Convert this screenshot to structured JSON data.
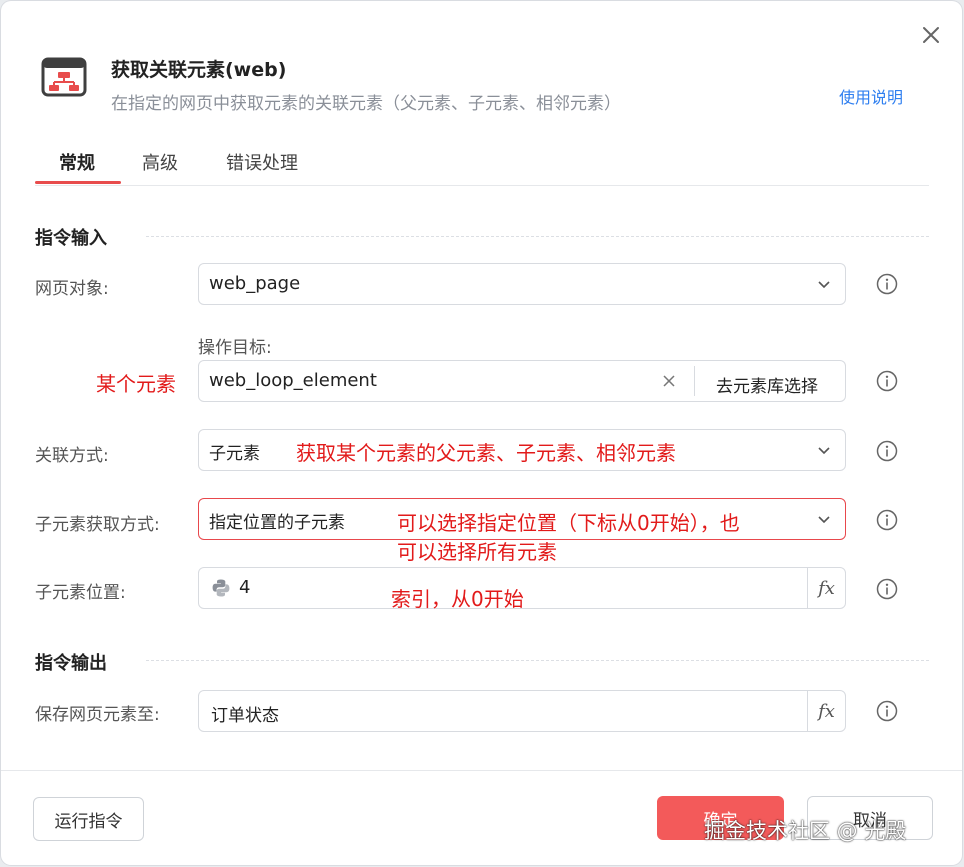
{
  "header": {
    "title": "获取关联元素(web)",
    "subtitle": "在指定的网页中获取元素的关联元素（父元素、子元素、相邻元素）",
    "help_link": "使用说明",
    "app_icon": "element-tree-icon",
    "close_icon": "close-icon"
  },
  "tabs": [
    {
      "label": "常规",
      "active": true
    },
    {
      "label": "高级",
      "active": false
    },
    {
      "label": "错误处理",
      "active": false
    }
  ],
  "sections": {
    "input_title": "指令输入",
    "output_title": "指令输出"
  },
  "fields": {
    "web_page": {
      "label": "网页对象:",
      "value": "web_page"
    },
    "target": {
      "caption": "操作目标:",
      "value": "web_loop_element",
      "library_button": "去元素库选择"
    },
    "relation": {
      "label": "关联方式:",
      "value": "子元素"
    },
    "child_mode": {
      "label": "子元素获取方式:",
      "value": "指定位置的子元素"
    },
    "child_index": {
      "label": "子元素位置:",
      "value": "4",
      "fx": "fx"
    },
    "save_to": {
      "label": "保存网页元素至:",
      "value": "订单状态",
      "fx": "fx"
    }
  },
  "annotations": {
    "some_element": "某个元素",
    "relation_note": "获取某个元素的父元素、子元素、相邻元素",
    "child_mode_note_1": "可以选择指定位置（下标从0开始），也",
    "child_mode_note_2": "可以选择所有元素",
    "index_note": "索引，从0开始"
  },
  "footer": {
    "run_button": "运行指令",
    "ok_button": "确定",
    "cancel_button": "取消",
    "watermark": "掘金技术社区 @ 光殿"
  },
  "colors": {
    "accent": "#e84c4c",
    "primary_button": "#f35a5a",
    "link": "#2f7ff0",
    "annotation": "#e21a1a"
  }
}
